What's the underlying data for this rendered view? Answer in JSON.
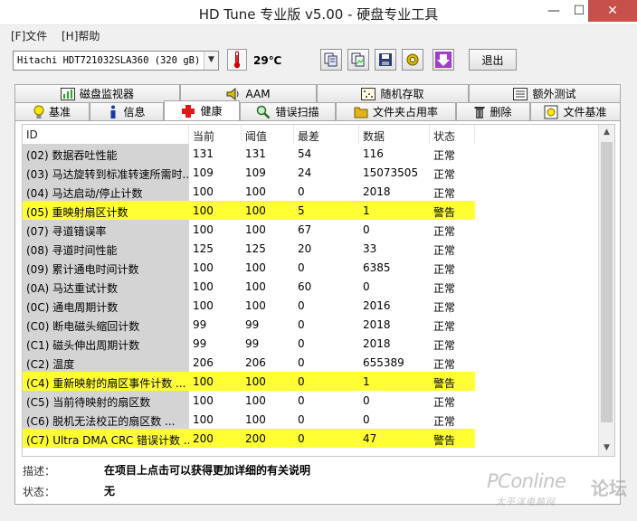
{
  "window": {
    "title": "HD Tune 专业版 v5.00 - 硬盘专业工具"
  },
  "menu": {
    "file": "[F]文件",
    "help": "[H]帮助"
  },
  "toolbar": {
    "drive": "Hitachi HDT721032SLA360 (320 gB)",
    "temperature": "29℃",
    "exit_label": "退出",
    "icons": [
      "copy-text-icon",
      "copy-image-icon",
      "save-icon",
      "options-icon",
      "download-icon"
    ]
  },
  "tabs_row1": [
    {
      "label": "磁盘监视器",
      "icon": "monitor-chart-icon"
    },
    {
      "label": "AAM",
      "icon": "speaker-icon"
    },
    {
      "label": "随机存取",
      "icon": "random-access-icon"
    },
    {
      "label": "额外测试",
      "icon": "extra-tests-icon"
    }
  ],
  "tabs_row2": [
    {
      "label": "基准",
      "icon": "benchmark-bulb-icon"
    },
    {
      "label": "信息",
      "icon": "info-icon"
    },
    {
      "label": "健康",
      "icon": "health-cross-icon",
      "active": true
    },
    {
      "label": "错误扫描",
      "icon": "magnifier-icon"
    },
    {
      "label": "文件夹占用率",
      "icon": "folder-icon"
    },
    {
      "label": "删除",
      "icon": "trash-icon"
    },
    {
      "label": "文件基准",
      "icon": "file-benchmark-icon"
    }
  ],
  "table": {
    "headers": [
      "ID",
      "当前",
      "阈值",
      "最差",
      "数据",
      "状态"
    ],
    "rows": [
      [
        "(02) 数据吞吐性能",
        "131",
        "131",
        "54",
        "116",
        "正常"
      ],
      [
        "(03) 马达旋转到标准转速所需时...",
        "109",
        "109",
        "24",
        "15073505",
        "正常"
      ],
      [
        "(04) 马达启动/停止计数",
        "100",
        "100",
        "0",
        "2018",
        "正常"
      ],
      [
        "(05) 重映射扇区计数",
        "100",
        "100",
        "5",
        "1",
        "警告"
      ],
      [
        "(07) 寻道错误率",
        "100",
        "100",
        "67",
        "0",
        "正常"
      ],
      [
        "(08) 寻道时间性能",
        "125",
        "125",
        "20",
        "33",
        "正常"
      ],
      [
        "(09) 累计通电时间计数",
        "100",
        "100",
        "0",
        "6385",
        "正常"
      ],
      [
        "(0A) 马达重试计数",
        "100",
        "100",
        "60",
        "0",
        "正常"
      ],
      [
        "(0C) 通电周期计数",
        "100",
        "100",
        "0",
        "2016",
        "正常"
      ],
      [
        "(C0) 断电磁头缩回计数",
        "99",
        "99",
        "0",
        "2018",
        "正常"
      ],
      [
        "(C1) 磁头伸出周期计数",
        "99",
        "99",
        "0",
        "2018",
        "正常"
      ],
      [
        "(C2) 温度",
        "206",
        "206",
        "0",
        "655389",
        "正常"
      ],
      [
        "(C4) 重新映射的扇区事件计数 ...",
        "100",
        "100",
        "0",
        "1",
        "警告"
      ],
      [
        "(C5) 当前待映射的扇区数",
        "100",
        "100",
        "0",
        "0",
        "正常"
      ],
      [
        "(C6) 脱机无法校正的扇区数 ...",
        "100",
        "100",
        "0",
        "0",
        "正常"
      ],
      [
        "(C7) Ultra DMA CRC 错误计数 ...",
        "200",
        "200",
        "0",
        "47",
        "警告"
      ]
    ],
    "warn_color": "#ffff33"
  },
  "details": {
    "desc_label": "描述：",
    "desc_text": "在项目上点击可以获得更加详细的有关说明",
    "status_label": "状态：",
    "status_text": "无"
  },
  "watermark": {
    "main": "PConline",
    "sub": "太平洋电脑网",
    "side": "论坛"
  }
}
